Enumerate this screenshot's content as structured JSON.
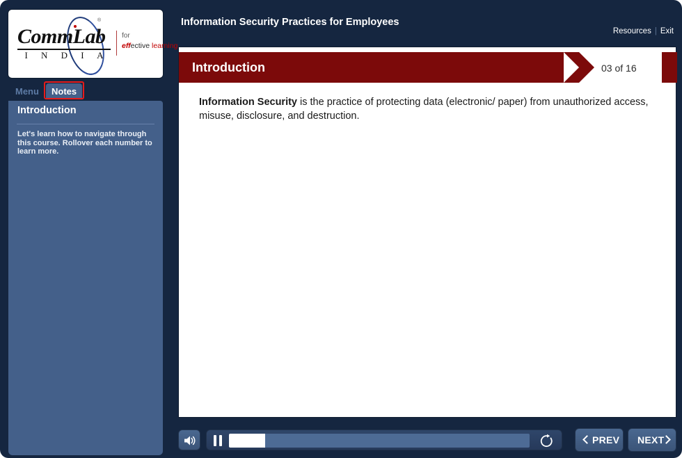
{
  "brand": {
    "logo_name": "CommLab",
    "logo_country": "I N D I A",
    "tagline_line1": "for",
    "tagline_eff": "eff",
    "tagline_ective": "ective",
    "tagline_learning": " learning",
    "registered_mark": "®"
  },
  "header": {
    "course_title": "Information Security Practices for Employees",
    "resources_label": "Resources",
    "separator": "|",
    "exit_label": "Exit"
  },
  "sidebar": {
    "tabs": [
      {
        "id": "menu",
        "label": "Menu",
        "active": false
      },
      {
        "id": "notes",
        "label": "Notes",
        "active": true
      }
    ],
    "notes": {
      "title": "Introduction",
      "body": "Let's learn how to navigate through this course. Rollover each number to learn more."
    },
    "highlight_color": "#e81b1b"
  },
  "slide": {
    "banner_label": "Introduction",
    "counter": "03 of 16",
    "banner_color": "#7c0a0a",
    "body_bold": "Information Security",
    "body_rest": " is the practice of protecting data (electronic/ paper) from unauthorized access, misuse, disclosure, and destruction."
  },
  "controls": {
    "volume_icon": "speaker-icon",
    "pause_icon": "pause-icon",
    "replay_icon": "replay-icon",
    "progress_percent": 12,
    "prev_label": "PREV",
    "next_label": "NEXT",
    "prev_icon": "chevron-left-icon",
    "next_icon": "chevron-right-icon"
  },
  "theme": {
    "frame_navy": "#152640",
    "panel_blue": "#44608a",
    "accent_red": "#7c0a0a",
    "stage_white": "#ffffff"
  }
}
